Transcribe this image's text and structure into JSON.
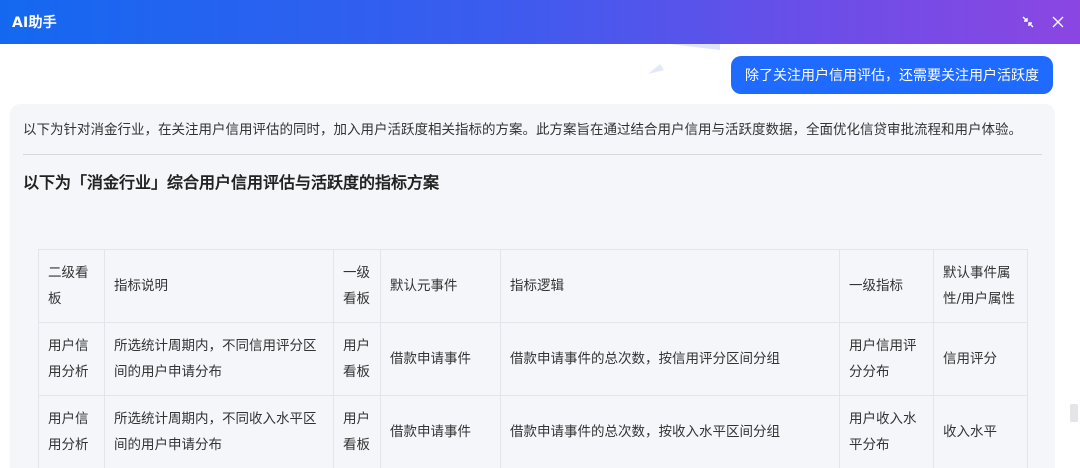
{
  "window": {
    "title": "AI助手"
  },
  "user_message": "除了关注用户信用评估，还需要关注用户活跃度",
  "answer": {
    "intro": "以下为针对消金行业，在关注用户信用评估的同时，加入用户活跃度相关指标的方案。此方案旨在通过结合用户信用与活跃度数据，全面优化信贷审批流程和用户体验。",
    "heading": "以下为「消金行业」综合用户信用评估与活跃度的指标方案",
    "table": {
      "headers": [
        "二级看板",
        "指标说明",
        "一级看板",
        "默认元事件",
        "指标逻辑",
        "一级指标",
        "默认事件属性/用户属性"
      ],
      "rows": [
        [
          "用户信用分析",
          "所选统计周期内，不同信用评分区间的用户申请分布",
          "用户看板",
          "借款申请事件",
          "借款申请事件的总次数，按信用评分区间分组",
          "用户信用评分分布",
          "信用评分"
        ],
        [
          "用户信用分析",
          "所选统计周期内，不同收入水平区间的用户申请分布",
          "用户看板",
          "借款申请事件",
          "借款申请事件的总次数，按收入水平区间分组",
          "用户收入水平分布",
          "收入水平"
        ]
      ]
    }
  },
  "icons": {
    "minimize": "shrink-icon",
    "close": "close-icon"
  },
  "colors": {
    "accent": "#1f6bff",
    "titlebar_start": "#1468f0",
    "titlebar_end": "#8b46e2"
  }
}
